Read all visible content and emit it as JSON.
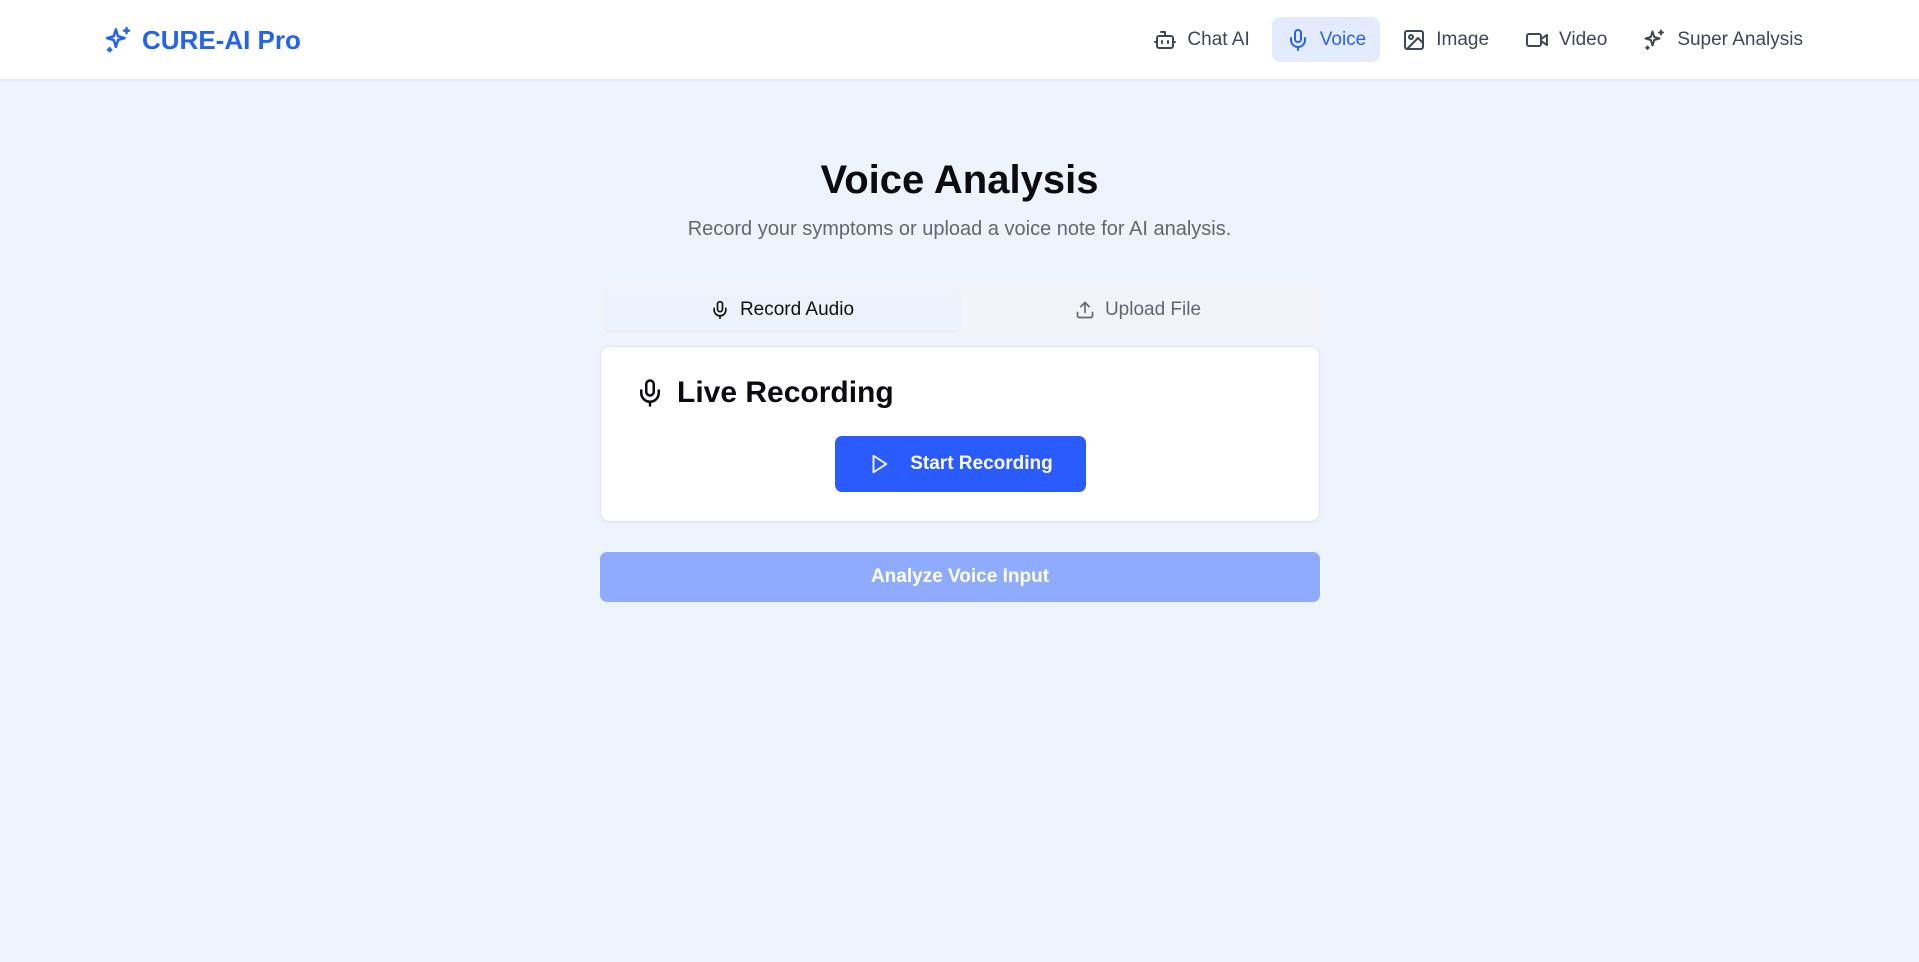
{
  "brand": {
    "name": "CURE-AI Pro",
    "icon": "sparkles-icon",
    "color": "#2563eb"
  },
  "nav": {
    "items": [
      {
        "label": "Chat AI",
        "icon": "bot-icon",
        "active": false
      },
      {
        "label": "Voice",
        "icon": "microphone-icon",
        "active": true
      },
      {
        "label": "Image",
        "icon": "image-icon",
        "active": false
      },
      {
        "label": "Video",
        "icon": "video-camera-icon",
        "active": false
      },
      {
        "label": "Super Analysis",
        "icon": "sparkles-icon",
        "active": false
      }
    ]
  },
  "page": {
    "title": "Voice Analysis",
    "subtitle": "Record your symptoms or upload a voice note for AI analysis."
  },
  "tabs": {
    "items": [
      {
        "label": "Record Audio",
        "icon": "microphone-icon",
        "active": true
      },
      {
        "label": "Upload File",
        "icon": "upload-icon",
        "active": false
      }
    ]
  },
  "recording_card": {
    "title": "Live Recording",
    "icon": "microphone-icon",
    "start_button_label": "Start Recording",
    "start_button_icon": "play-icon"
  },
  "analyze_button": {
    "label": "Analyze Voice Input",
    "disabled": true
  },
  "colors": {
    "accent": "#2a5bff",
    "accent_disabled": "#8eabfd",
    "page_background": "#eef4fd",
    "nav_active_background": "#e4ebff"
  }
}
